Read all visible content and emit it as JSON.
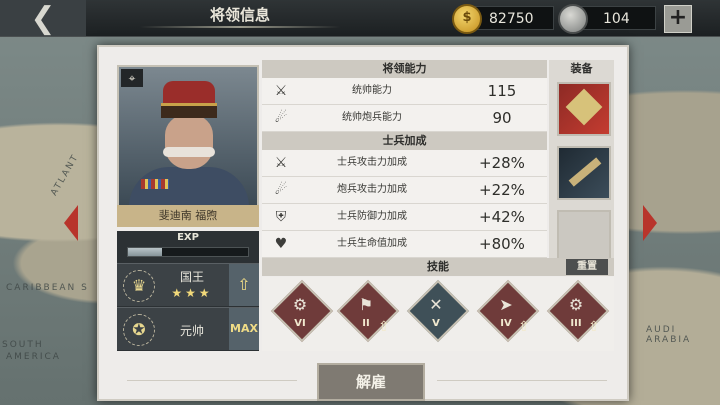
{
  "header": {
    "back_icon": "back-arrow-icon",
    "title": "将领信息",
    "gold": "82750",
    "medals": "104",
    "add_icon": "plus-icon"
  },
  "map_labels": [
    "ATLANT",
    "CARIBBEAN S",
    "SOUTH",
    "AMERICA",
    "AUDI ARABIA"
  ],
  "general": {
    "name": "斐迪南 福煦",
    "portrait": "general-portrait",
    "type_icon": "artillery-icon",
    "exp_label": "EXP",
    "exp_progress": 0.28,
    "rank1": {
      "title": "国王",
      "stars": "★★★",
      "icon": "crown-icon"
    },
    "rank2": {
      "title": "元帅",
      "max_label": "MAX",
      "icon": "marshal-icon"
    }
  },
  "abilities": {
    "header": "将领能力",
    "rows": [
      {
        "label": "统帅能力",
        "value": "115",
        "icon": "crossed-swords-icon"
      },
      {
        "label": "统帅炮兵能力",
        "value": "90",
        "icon": "cannon-icon"
      }
    ]
  },
  "bonuses": {
    "header": "士兵加成",
    "rows": [
      {
        "label": "士兵攻击力加成",
        "value": "+28%",
        "icon": "attack-icon"
      },
      {
        "label": "炮兵攻击力加成",
        "value": "+22%",
        "icon": "artillery-attack-icon"
      },
      {
        "label": "士兵防御力加成",
        "value": "+42%",
        "icon": "shield-icon"
      },
      {
        "label": "士兵生命值加成",
        "value": "+80%",
        "icon": "heart-icon"
      }
    ]
  },
  "equipment": {
    "header": "装备",
    "slots": [
      "medal-item",
      "shells-item",
      "empty-slot"
    ]
  },
  "skills": {
    "header": "技能",
    "reset_label": "重置",
    "items": [
      {
        "roman": "VI",
        "symbol": "⚙",
        "color": "#6f3b3a",
        "upgradable": false
      },
      {
        "roman": "II",
        "symbol": "⚑",
        "color": "#6f3b3a",
        "upgradable": true
      },
      {
        "roman": "V",
        "symbol": "✕",
        "color": "#3f5058",
        "upgradable": false
      },
      {
        "roman": "IV",
        "symbol": "➤",
        "color": "#6f3b3a",
        "upgradable": true
      },
      {
        "roman": "III",
        "symbol": "⚙",
        "color": "#6f3b3a",
        "upgradable": true
      }
    ]
  },
  "dismiss_label": "解雇"
}
